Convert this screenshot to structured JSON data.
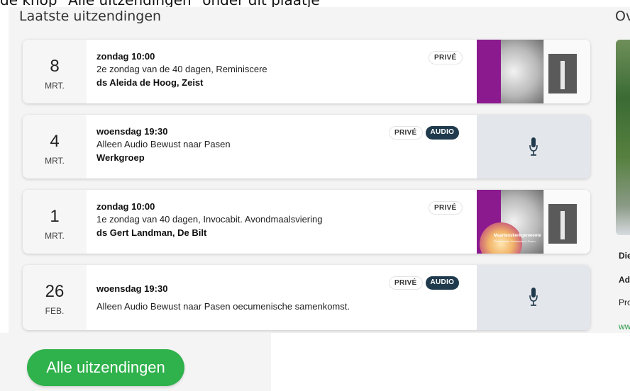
{
  "top_caption": "de knop \"Alle uitzendingen\" onder dit plaatje",
  "section_title": "Laatste uitzendingen",
  "side": {
    "title": "Ov",
    "line1": "Die",
    "line2": "Ad",
    "line3": "Pro",
    "link": "ww"
  },
  "broadcasts": [
    {
      "day": "8",
      "month": "MRT.",
      "time": "zondag 10:00",
      "description": "2e zondag van de 40 dagen, Reminiscere",
      "preacher": "ds Aleida de Hoog, Zeist",
      "badges": [
        "PRIVÉ"
      ],
      "thumb": "image"
    },
    {
      "day": "4",
      "month": "MRT.",
      "time": "woensdag 19:30",
      "description": "Alleen Audio Bewust naar Pasen",
      "preacher": "Werkgroep",
      "badges": [
        "PRIVÉ",
        "AUDIO"
      ],
      "thumb": "microphone-icon"
    },
    {
      "day": "1",
      "month": "MRT.",
      "time": "zondag 10:00",
      "description": "1e zondag van 40 dagen, Invocabit. Avondmaalsviering",
      "preacher": "ds Gert Landman, De Bilt",
      "badges": [
        "PRIVÉ"
      ],
      "thumb": "image",
      "thumb_logo": "Maartenskerkgemeente",
      "thumb_logo_sub": "Protestantse Gemeente te Doorn"
    },
    {
      "day": "26",
      "month": "FEB.",
      "time": "woensdag 19:30",
      "description": "Alleen Audio Bewust naar Pasen oecumenische samenkomst.",
      "preacher": "",
      "badges": [
        "PRIVÉ",
        "AUDIO"
      ],
      "thumb": "microphone-icon"
    }
  ],
  "all_button_label": "Alle uitzendingen",
  "colors": {
    "accent_green": "#2fb14b",
    "audio_badge": "#1f3a4d",
    "purple": "#8a1a8e"
  }
}
